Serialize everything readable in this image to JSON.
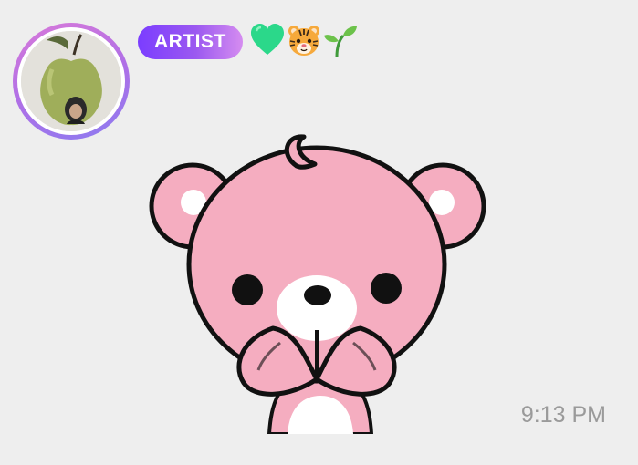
{
  "message": {
    "sender_badge": "ARTIST",
    "badge_emojis": [
      "green-heart",
      "tiger-face",
      "seedling"
    ],
    "sticker": "pink-bear-covering-mouth",
    "timestamp": "9:13 PM"
  },
  "colors": {
    "background": "#eeeeee",
    "badge_gradient_start": "#7b3dff",
    "badge_gradient_end": "#d58cf0",
    "avatar_ring": "#b06fe6",
    "bear_pink": "#f5adc0",
    "timestamp_text": "#9a9a9a"
  }
}
